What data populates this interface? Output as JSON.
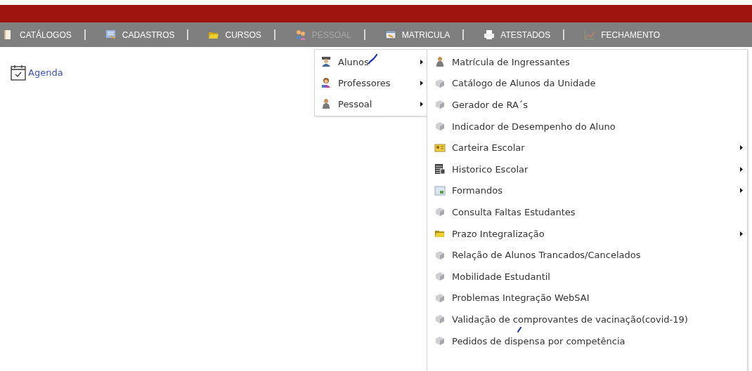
{
  "nav": [
    {
      "label": "CATÁLOGOS",
      "kind": "book",
      "selected": false
    },
    {
      "label": "CADASTROS",
      "kind": "form",
      "selected": false
    },
    {
      "label": "CURSOS",
      "kind": "folder",
      "selected": false
    },
    {
      "label": "PESSOAL",
      "kind": "people",
      "selected": true
    },
    {
      "label": "MATRICULA",
      "kind": "card",
      "selected": false
    },
    {
      "label": "ATESTADOS",
      "kind": "printer",
      "selected": false
    },
    {
      "label": "FECHAMENTO",
      "kind": "chart",
      "selected": false
    }
  ],
  "shortcut": {
    "label": "Agenda"
  },
  "menu": [
    {
      "label": "Alunos",
      "kind": "students",
      "has_submenu": true
    },
    {
      "label": "Professores",
      "kind": "teacher",
      "has_submenu": true
    },
    {
      "label": "Pessoal",
      "kind": "person",
      "has_submenu": true
    }
  ],
  "submenu": [
    {
      "label": "Matrícula de Ingressantes",
      "kind": "person",
      "has_submenu": false
    },
    {
      "label": "Catálogo de Alunos da Unidade",
      "kind": "cube",
      "has_submenu": false
    },
    {
      "label": "Gerador de RA´s",
      "kind": "cube",
      "has_submenu": false
    },
    {
      "label": "Indicador de Desempenho do Aluno",
      "kind": "cube",
      "has_submenu": false
    },
    {
      "label": "Carteira Escolar",
      "kind": "card",
      "has_submenu": true
    },
    {
      "label": "Historico Escolar",
      "kind": "table",
      "has_submenu": true
    },
    {
      "label": "Formandos",
      "kind": "image",
      "has_submenu": true
    },
    {
      "label": "Consulta Faltas Estudantes",
      "kind": "cube",
      "has_submenu": false
    },
    {
      "label": "Prazo Integralização",
      "kind": "folder",
      "has_submenu": true
    },
    {
      "label": "Relação de Alunos Trancados/Cancelados",
      "kind": "cube",
      "has_submenu": false
    },
    {
      "label": "Mobilidade Estudantil",
      "kind": "cube",
      "has_submenu": false
    },
    {
      "label": "Problemas Integração WebSAI",
      "kind": "cube",
      "has_submenu": false
    },
    {
      "label": "Validação de comprovantes de vacinação(covid-19)",
      "kind": "cube",
      "has_submenu": false
    },
    {
      "label": "Pedidos de dispensa por competência",
      "kind": "cube",
      "has_submenu": false
    }
  ]
}
